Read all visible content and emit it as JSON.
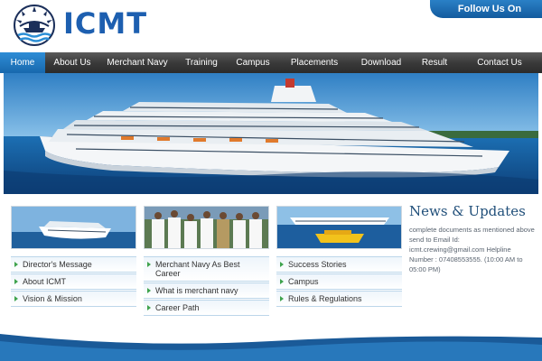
{
  "header": {
    "logo_text": "ICMT",
    "follow_label": "Follow Us On"
  },
  "nav": {
    "items": [
      {
        "label": "Home",
        "active": true
      },
      {
        "label": "About Us",
        "active": false
      },
      {
        "label": "Merchant Navy",
        "active": false
      },
      {
        "label": "Training",
        "active": false
      },
      {
        "label": "Campus",
        "active": false
      },
      {
        "label": "Placements",
        "active": false
      },
      {
        "label": "Download",
        "active": false
      },
      {
        "label": "Result",
        "active": false
      },
      {
        "label": "Contact Us",
        "active": false
      }
    ]
  },
  "columns": [
    {
      "links": [
        "Director's Message",
        "About ICMT",
        "Vision & Mission"
      ]
    },
    {
      "links": [
        "Merchant Navy As Best Career",
        "What is merchant navy",
        "Career Path"
      ]
    },
    {
      "links": [
        "Success Stories",
        "Campus",
        "Rules & Regulations"
      ]
    }
  ],
  "news": {
    "title": "News & Updates",
    "text": "complete documents as mentioned above send to Email Id: icmt.crewing@gmail.com Helpline Number : 07408553555. (10:00 AM to 05:00 PM)"
  },
  "colors": {
    "brand_blue": "#1d5fb0",
    "nav_dark": "#3a3a3a",
    "nav_active": "#1f76bf",
    "link_arrow": "#3fa34d",
    "news_title": "#1f4e79"
  },
  "icons": {
    "logo": "anchor-ship-emblem-icon",
    "link_bullet": "arrow-right-icon"
  }
}
